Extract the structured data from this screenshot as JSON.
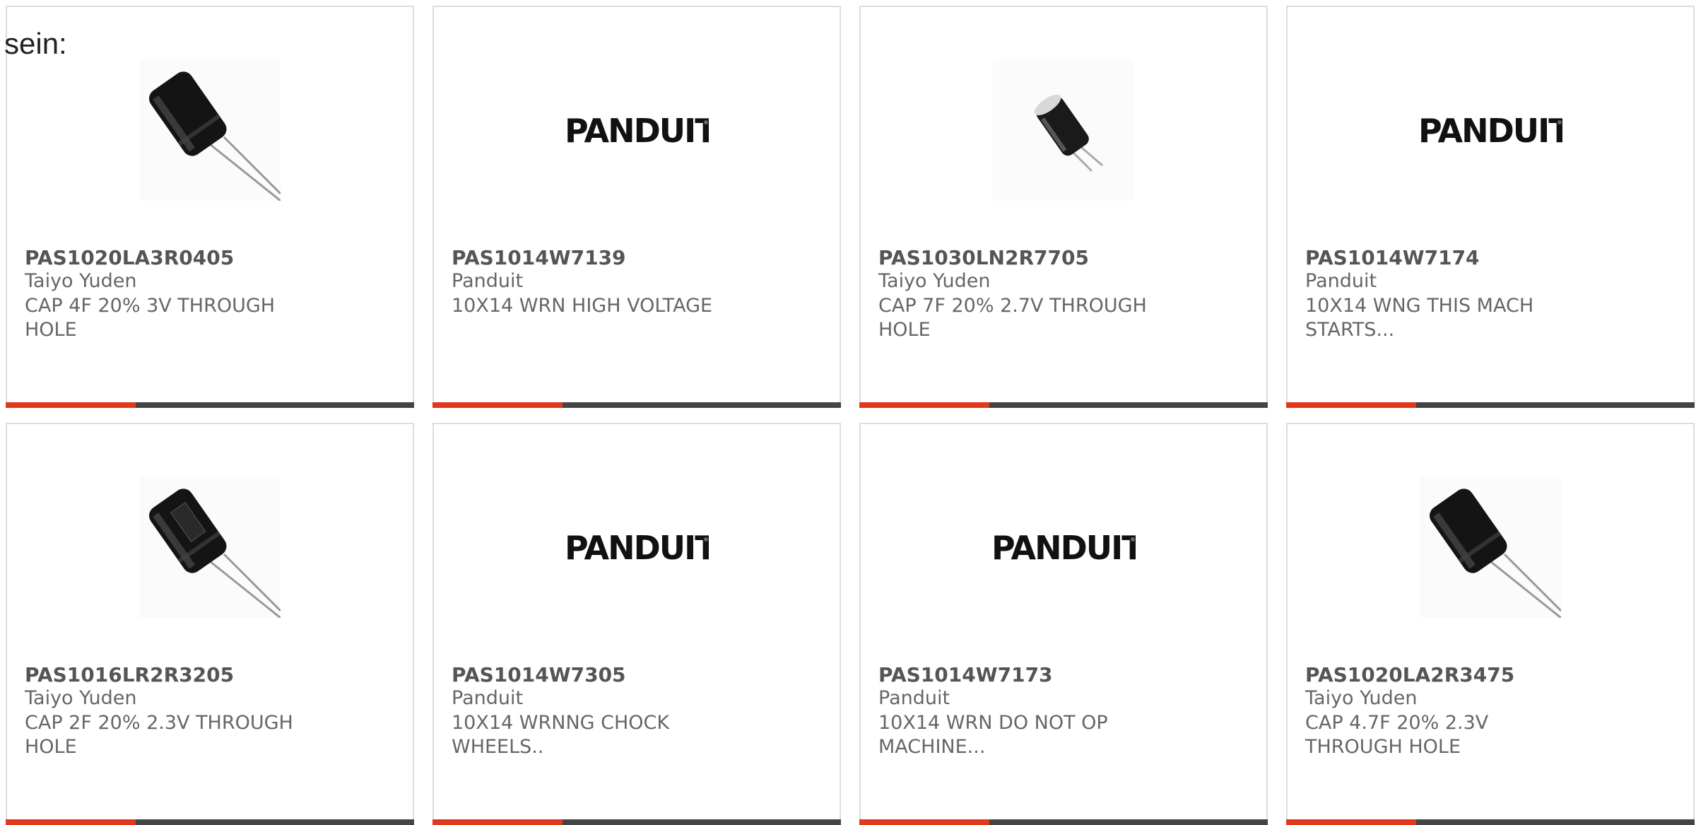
{
  "page": {
    "intro_text": "sein:"
  },
  "colors": {
    "accent": "#e0391c",
    "bar": "#444444",
    "border": "#dddddd",
    "text": "#666666"
  },
  "products": [
    {
      "part": "PAS1020LA3R0405",
      "manufacturer": "Taiyo Yuden",
      "description": "CAP 4F 20% 3V THROUGH HOLE",
      "image": "capacitor-tilted",
      "logo_text": ""
    },
    {
      "part": "PAS1014W7139",
      "manufacturer": "Panduit",
      "description": "10X14 WRN HIGH VOLTAGE",
      "image": "panduit-logo",
      "logo_text": "PANDUIT"
    },
    {
      "part": "PAS1030LN2R7705",
      "manufacturer": "Taiyo Yuden",
      "description": "CAP 7F 20% 2.7V THROUGH HOLE",
      "image": "capacitor-small",
      "logo_text": ""
    },
    {
      "part": "PAS1014W7174",
      "manufacturer": "Panduit",
      "description": "10X14 WNG THIS MACH STARTS...",
      "image": "panduit-logo",
      "logo_text": "PANDUIT"
    },
    {
      "part": "PAS1016LR2R3205",
      "manufacturer": "Taiyo Yuden",
      "description": "CAP 2F 20% 2.3V THROUGH HOLE",
      "image": "capacitor-tilted-label",
      "logo_text": ""
    },
    {
      "part": "PAS1014W7305",
      "manufacturer": "Panduit",
      "description": "10X14 WRNNG CHOCK WHEELS..",
      "image": "panduit-logo",
      "logo_text": "PANDUIT"
    },
    {
      "part": "PAS1014W7173",
      "manufacturer": "Panduit",
      "description": "10X14 WRN DO NOT OP MACHINE...",
      "image": "panduit-logo",
      "logo_text": "PANDUIT"
    },
    {
      "part": "PAS1020LA2R3475",
      "manufacturer": "Taiyo Yuden",
      "description": "CAP 4.7F 20% 2.3V THROUGH HOLE",
      "image": "capacitor-tilted",
      "logo_text": ""
    }
  ]
}
